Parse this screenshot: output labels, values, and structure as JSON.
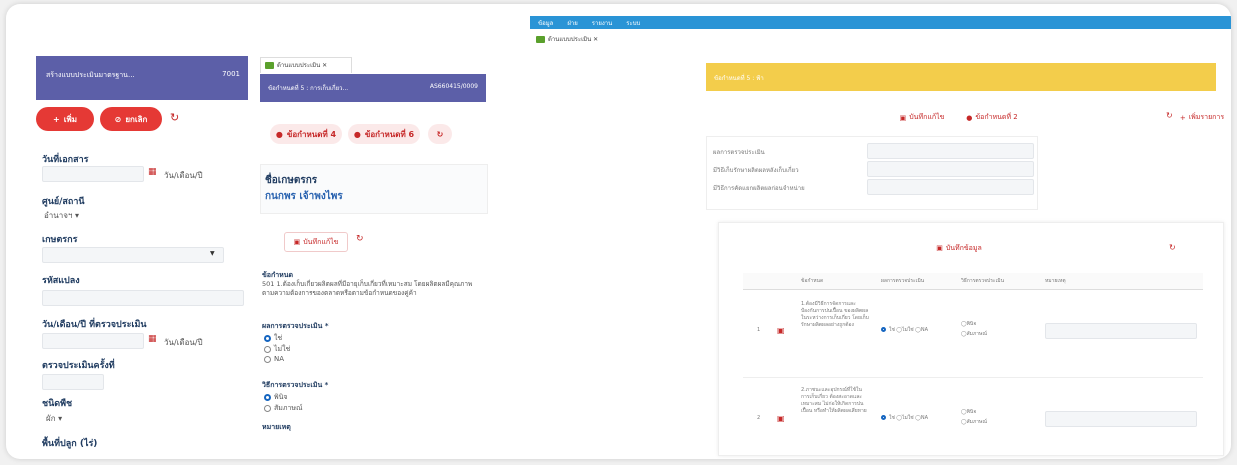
{
  "left_panel": {
    "header_title": "สร้างแบบประเมินมาตรฐาน...",
    "header_code": "7001",
    "add_label": "เพิ่ม",
    "cancel_label": "ยกเลิก",
    "doc_date_label": "วันที่เอกสาร",
    "date_placeholder": "วัน/เดือน/ปี",
    "center_label": "ศูนย์/สถานี",
    "center_value": "อำนาจฯ",
    "farmer_label": "เกษตรกร",
    "plot_label": "รหัสแปลง",
    "assess_date_label": "วัน/เดือน/ปี ที่ตรวจประเมิน",
    "assessor_label": "ตรวจประเมินครั้งที่",
    "crop_label": "ชนิดพืช",
    "crop_value": "ผัก",
    "area_label": "พื้นที่ปลูก (ไร่)"
  },
  "middle_panel": {
    "tab_label": "ด้านแบบประเมิน",
    "header_title": "ข้อกำหนดที่ 5 : การเก็บเกี่ยว...",
    "header_code": "AS660415/0009",
    "btn_req4": "ข้อกำหนดที่ 4",
    "btn_req6": "ข้อกำหนดที่ 6",
    "farmer_heading": "ชื่อเกษตรกร",
    "farmer_name": "กนกพร เจ้าพงไพร",
    "save_label": "บันทึกแก้ไข",
    "req_heading": "ข้อกำหนด",
    "req_text": "501 1.ต้องเก็บเกี่ยวผลิตผลที่มีอายุเก็บเกี่ยวที่เหมาะสม โดยผลิตผลมีคุณภาพตามความต้องการของตลาดหรือตามข้อกำหนดของคู่ค้า",
    "result_heading": "ผลการตรวจประเมิน *",
    "result_options": [
      "ใช่",
      "ไม่ใช่",
      "NA"
    ],
    "method_heading": "วิธีการตรวจประเมิน *",
    "method_options": [
      "พินิจ",
      "สัมภาษณ์"
    ],
    "note_heading": "หมายเหตุ"
  },
  "right_panel": {
    "nav_items": [
      "ข้อมูล",
      "ฝ่าย",
      "รายงาน",
      "ระบบ"
    ],
    "tab_label": "ด้านแบบประเมิน",
    "banner_title": "ข้อกำหนดที่ 5 : ฟ้า",
    "btn_save": "บันทึกแก้ไข",
    "btn_req2": "ข้อกำหนดที่ 2",
    "btn_add": "เพิ่มรายการ",
    "info_labels": [
      "ผลการตรวจประเมิน",
      "มีวิธีเก็บรักษาผลิตผลหลังเก็บเกี่ยว",
      "มีวิธีการคัดแยกผลิตผลก่อนจำหน่าย"
    ],
    "inner_save": "บันทึกข้อมูล",
    "table_headers": [
      "ข้อกำหนด",
      "ผลการตรวจประเมิน",
      "วิธีการตรวจประเมิน",
      "หมายเหตุ"
    ],
    "rows": [
      {
        "num": "1",
        "text": "1.ต้องมีวิธีการจัดการและป้องกันการปนเปื้อน ของผลิตผลในระหว่างการเก็บเกี่ยว โดยเก็บ รักษาผลิตผลอย่างถูกต้อง",
        "result": "ใช่ ◯ไม่ใช่ ◯NA",
        "method1": "พินิจ",
        "method2": "สัมภาษณ์"
      },
      {
        "num": "2",
        "text": "2.ภาชนะและอุปกรณ์ที่ใช้ในการเก็บเกี่ยว ต้องสะอาดและเหมาะสม ไม่ก่อให้เกิดการปนเปื้อน หรือทำให้ผลิตผลเสียหาย",
        "result": "ใช่ ◯ไม่ใช่ ◯NA",
        "method1": "พินิจ",
        "method2": "สัมภาษณ์"
      }
    ]
  }
}
